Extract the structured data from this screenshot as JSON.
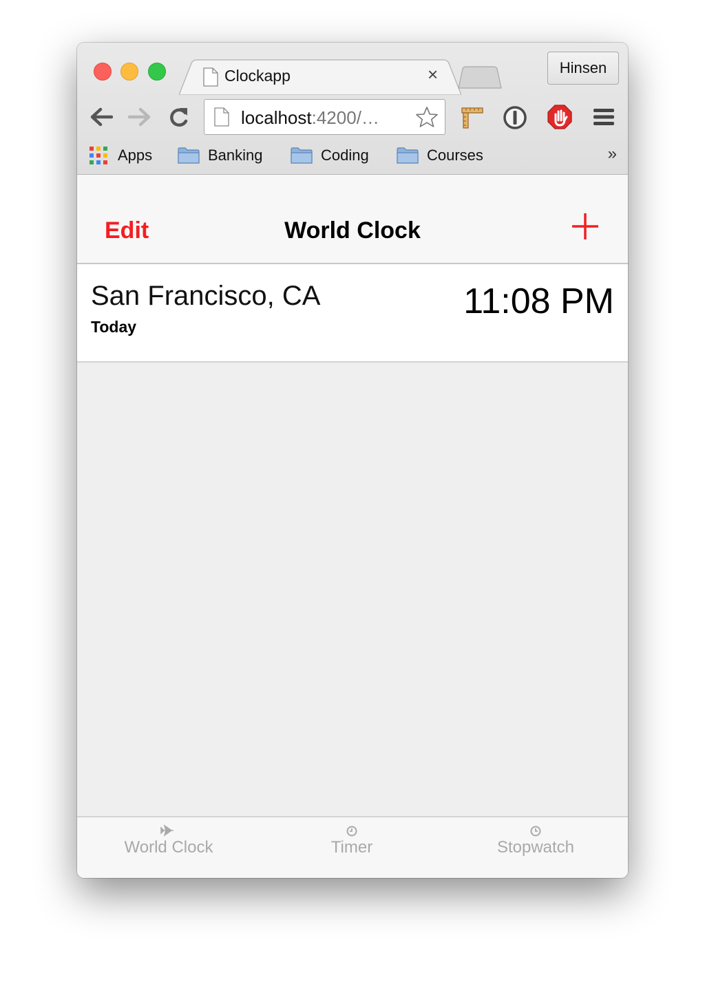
{
  "browser": {
    "tab_title": "Clockapp",
    "tab_close": "×",
    "profile_name": "Hinsen",
    "url_host": "localhost",
    "url_rest": ":4200/…",
    "bookmarks": [
      {
        "label": "Apps",
        "icon": "apps-grid-icon"
      },
      {
        "label": "Banking",
        "icon": "folder-icon"
      },
      {
        "label": "Coding",
        "icon": "folder-icon"
      },
      {
        "label": "Courses",
        "icon": "folder-icon"
      }
    ],
    "bookmarks_overflow": "»",
    "colors": {
      "close": "#fc605b",
      "minimize": "#fdbc40",
      "maximize": "#34c84a",
      "adblock": "#e02a2a"
    }
  },
  "app": {
    "nav": {
      "edit_label": "Edit",
      "title": "World Clock",
      "add_icon": "plus-icon"
    },
    "clocks": [
      {
        "city": "San Francisco, CA",
        "day": "Today",
        "time": "11:08 PM"
      }
    ],
    "tabs": [
      {
        "label": "World Clock",
        "icon": "airplane-icon"
      },
      {
        "label": "Timer",
        "icon": "clock-icon"
      },
      {
        "label": "Stopwatch",
        "icon": "stopwatch-icon"
      }
    ],
    "accent_color": "#f41e22",
    "inactive_tab_color": "#a9a9a9"
  }
}
